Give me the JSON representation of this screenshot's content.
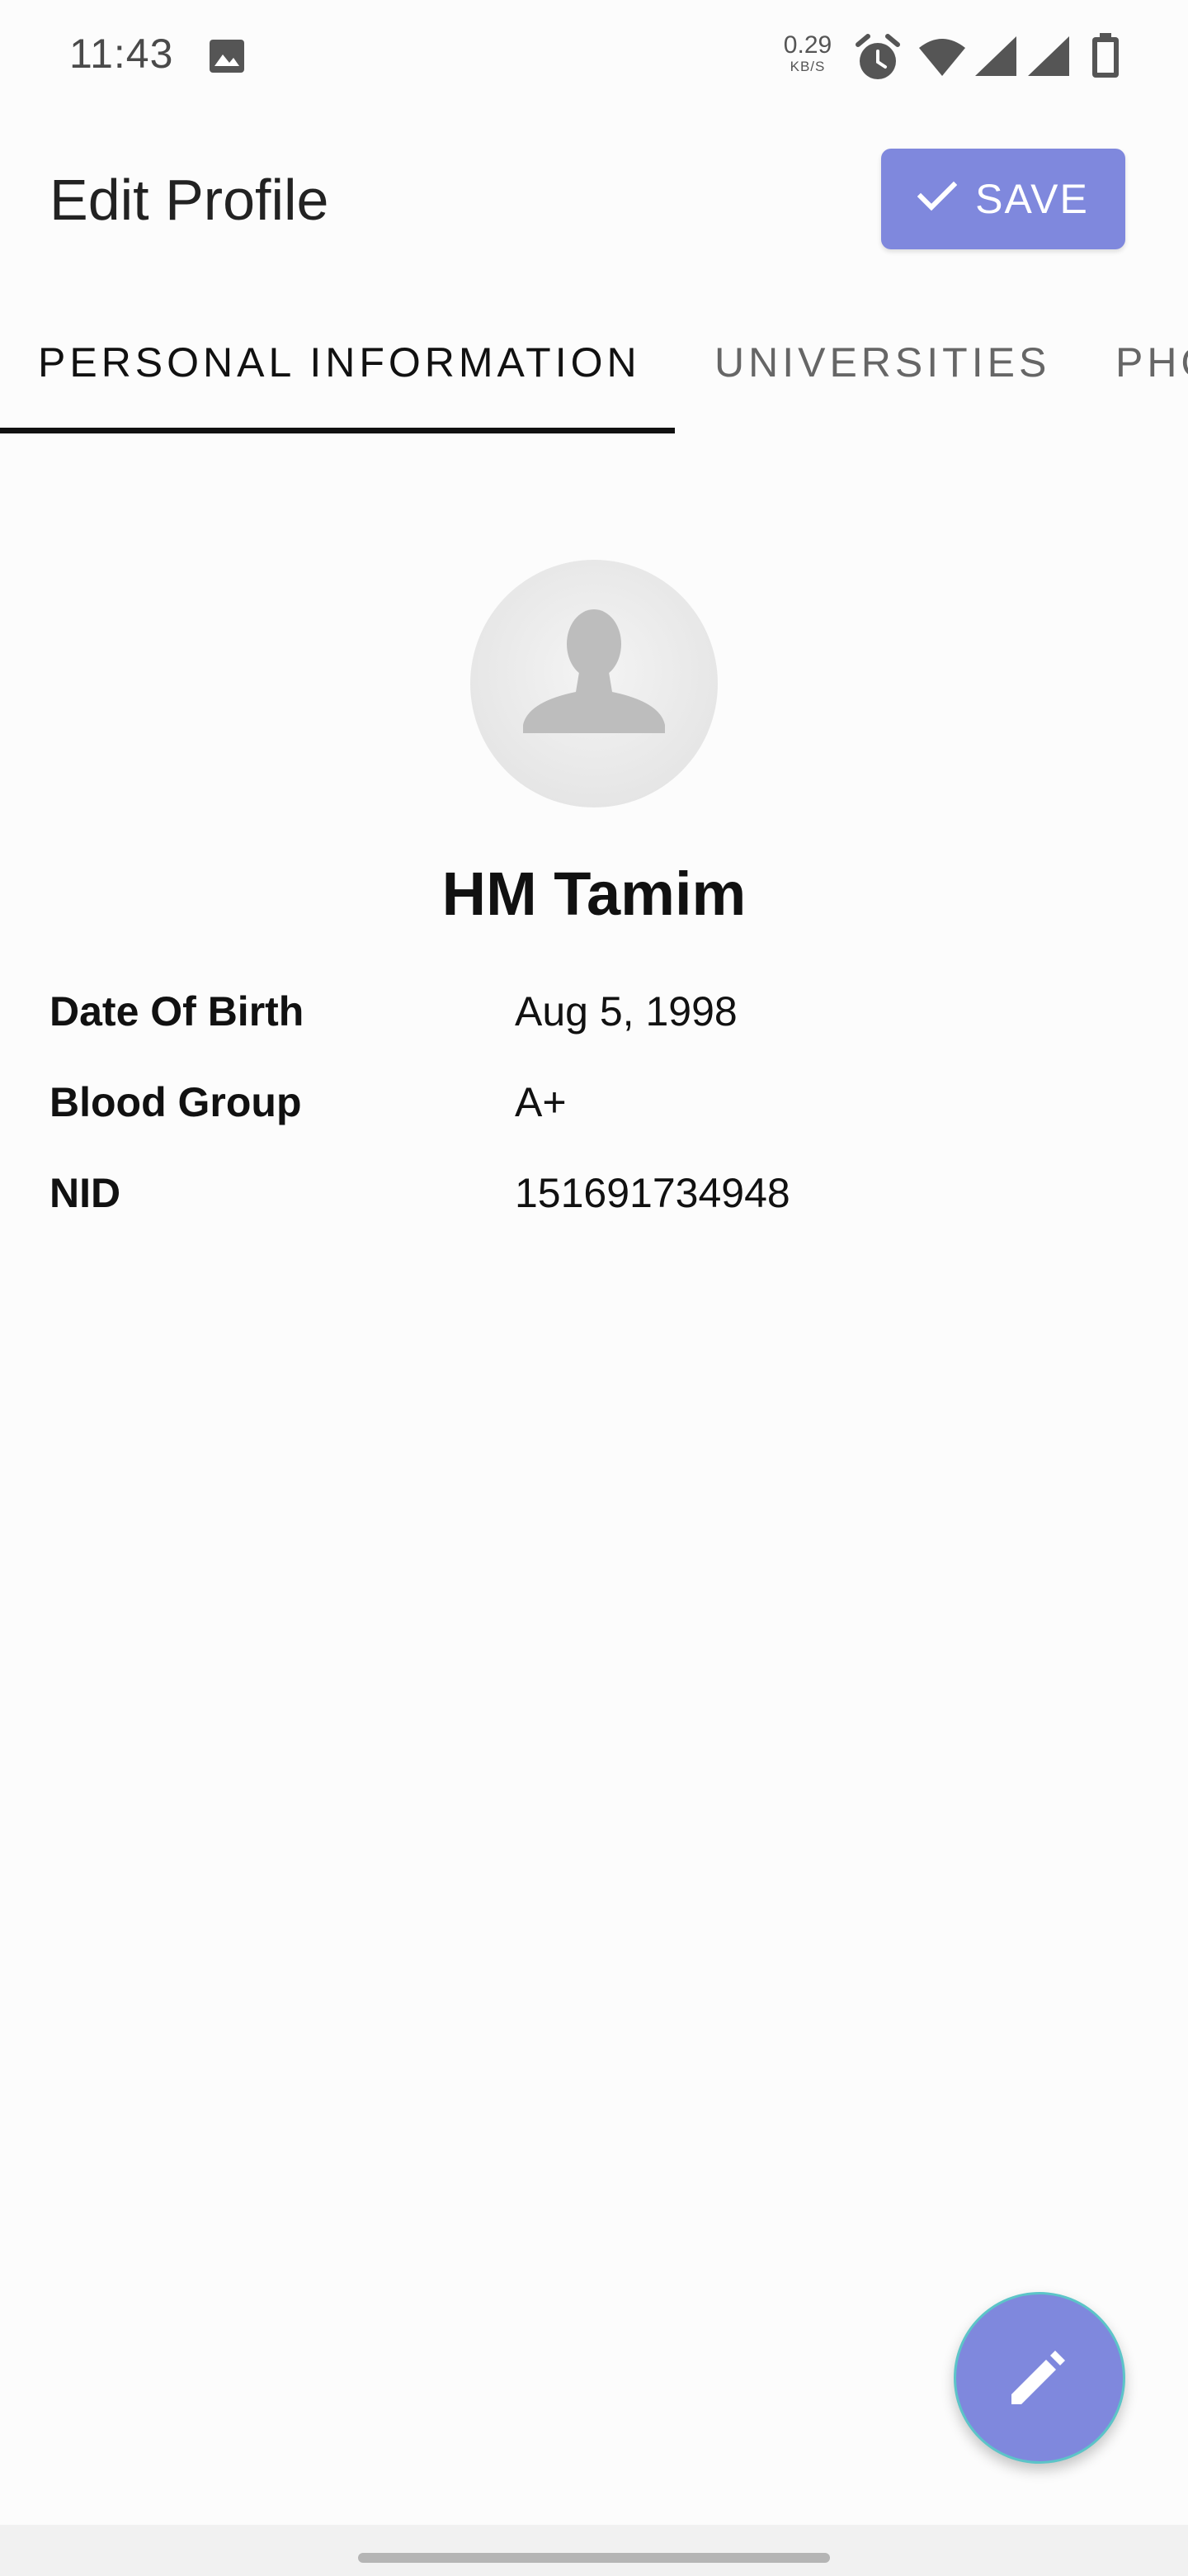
{
  "status_bar": {
    "time": "11:43",
    "network_speed": "0.29",
    "network_speed_unit": "KB/S",
    "icons": [
      "gallery-icon",
      "alarm-icon",
      "wifi-icon",
      "signal-icon",
      "signal-icon",
      "battery-icon"
    ]
  },
  "app_bar": {
    "title": "Edit Profile",
    "save_label": "SAVE",
    "save_icon": "check-icon",
    "accent_color": "#7f88dd"
  },
  "tabs": [
    {
      "label": "PERSONAL INFORMATION",
      "selected": true
    },
    {
      "label": "UNIVERSITIES",
      "selected": false
    },
    {
      "label": "PHO",
      "selected": false
    }
  ],
  "profile": {
    "avatar_icon": "person-placeholder-icon",
    "name": "HM Tamim",
    "fields": [
      {
        "label": "Date Of Birth",
        "value": "Aug 5, 1998"
      },
      {
        "label": "Blood Group",
        "value": "A+"
      },
      {
        "label": "NID",
        "value": "151691734948"
      }
    ]
  },
  "fab": {
    "icon": "pencil-icon"
  }
}
